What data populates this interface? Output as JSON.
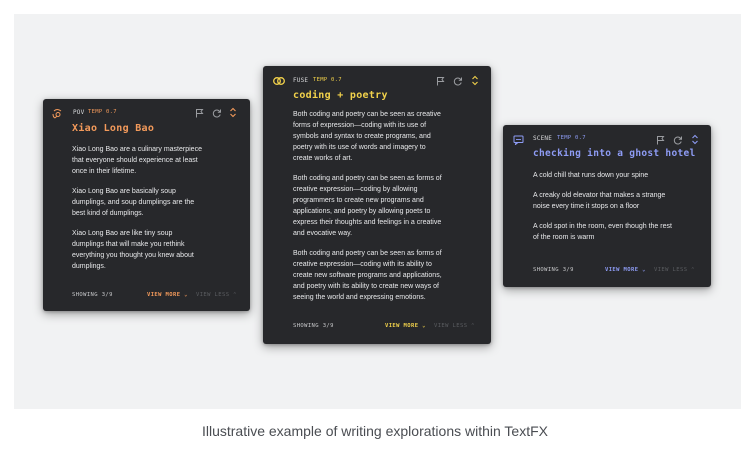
{
  "caption": "Illustrative example of writing explorations within TextFX",
  "colors": {
    "pov_accent": "#f39a5b",
    "fuse_accent": "#f2d24b",
    "scene_accent": "#8e9cf5",
    "card_bg": "#27282b",
    "stage_bg": "#f1f2f3"
  },
  "cards": [
    {
      "mode": "POV",
      "icon": "pov-icon",
      "temp": "TEMP 0.7",
      "title": "Xiao Long Bao",
      "paragraphs": [
        "Xiao Long Bao are a culinary masterpiece that everyone should experience at least once in their lifetime.",
        "Xiao Long Bao are basically soup dumplings, and soup dumplings are the best kind of dumplings.",
        "Xiao Long Bao are like tiny soup dumplings that will make you rethink everything you thought you knew about dumplings."
      ],
      "showing": "SHOWING 3/9",
      "view_more": "VIEW MORE ⌄",
      "view_less": "VIEW LESS ⌃"
    },
    {
      "mode": "FUSE",
      "icon": "fuse-icon",
      "temp": "TEMP 0.7",
      "title": "coding + poetry",
      "paragraphs": [
        "Both coding and poetry can be seen as creative forms of expression—coding with its use of symbols and syntax to create programs, and poetry with its use of words and imagery to create works of art.",
        "Both coding and poetry can be seen as forms of creative expression—coding by allowing programmers to create new programs and applications, and poetry by allowing poets to express their thoughts and feelings in a creative and evocative way.",
        "Both coding and poetry can be seen as forms of creative expression—coding with its ability to create new software programs and applications, and poetry with its ability to create new ways of seeing the world and expressing emotions."
      ],
      "showing": "SHOWING 3/9",
      "view_more": "VIEW MORE ⌄",
      "view_less": "VIEW LESS ⌃"
    },
    {
      "mode": "SCENE",
      "icon": "scene-icon",
      "temp": "TEMP 0.7",
      "title": "checking into a ghost hotel",
      "paragraphs": [
        "A cold chill that runs down your spine",
        "A creaky old elevator that makes a strange noise every time it stops on a floor",
        "A cold spot in the room, even though the rest of the room is warm"
      ],
      "showing": "SHOWING 3/9",
      "view_more": "VIEW MORE ⌄",
      "view_less": "VIEW LESS ⌃"
    }
  ]
}
